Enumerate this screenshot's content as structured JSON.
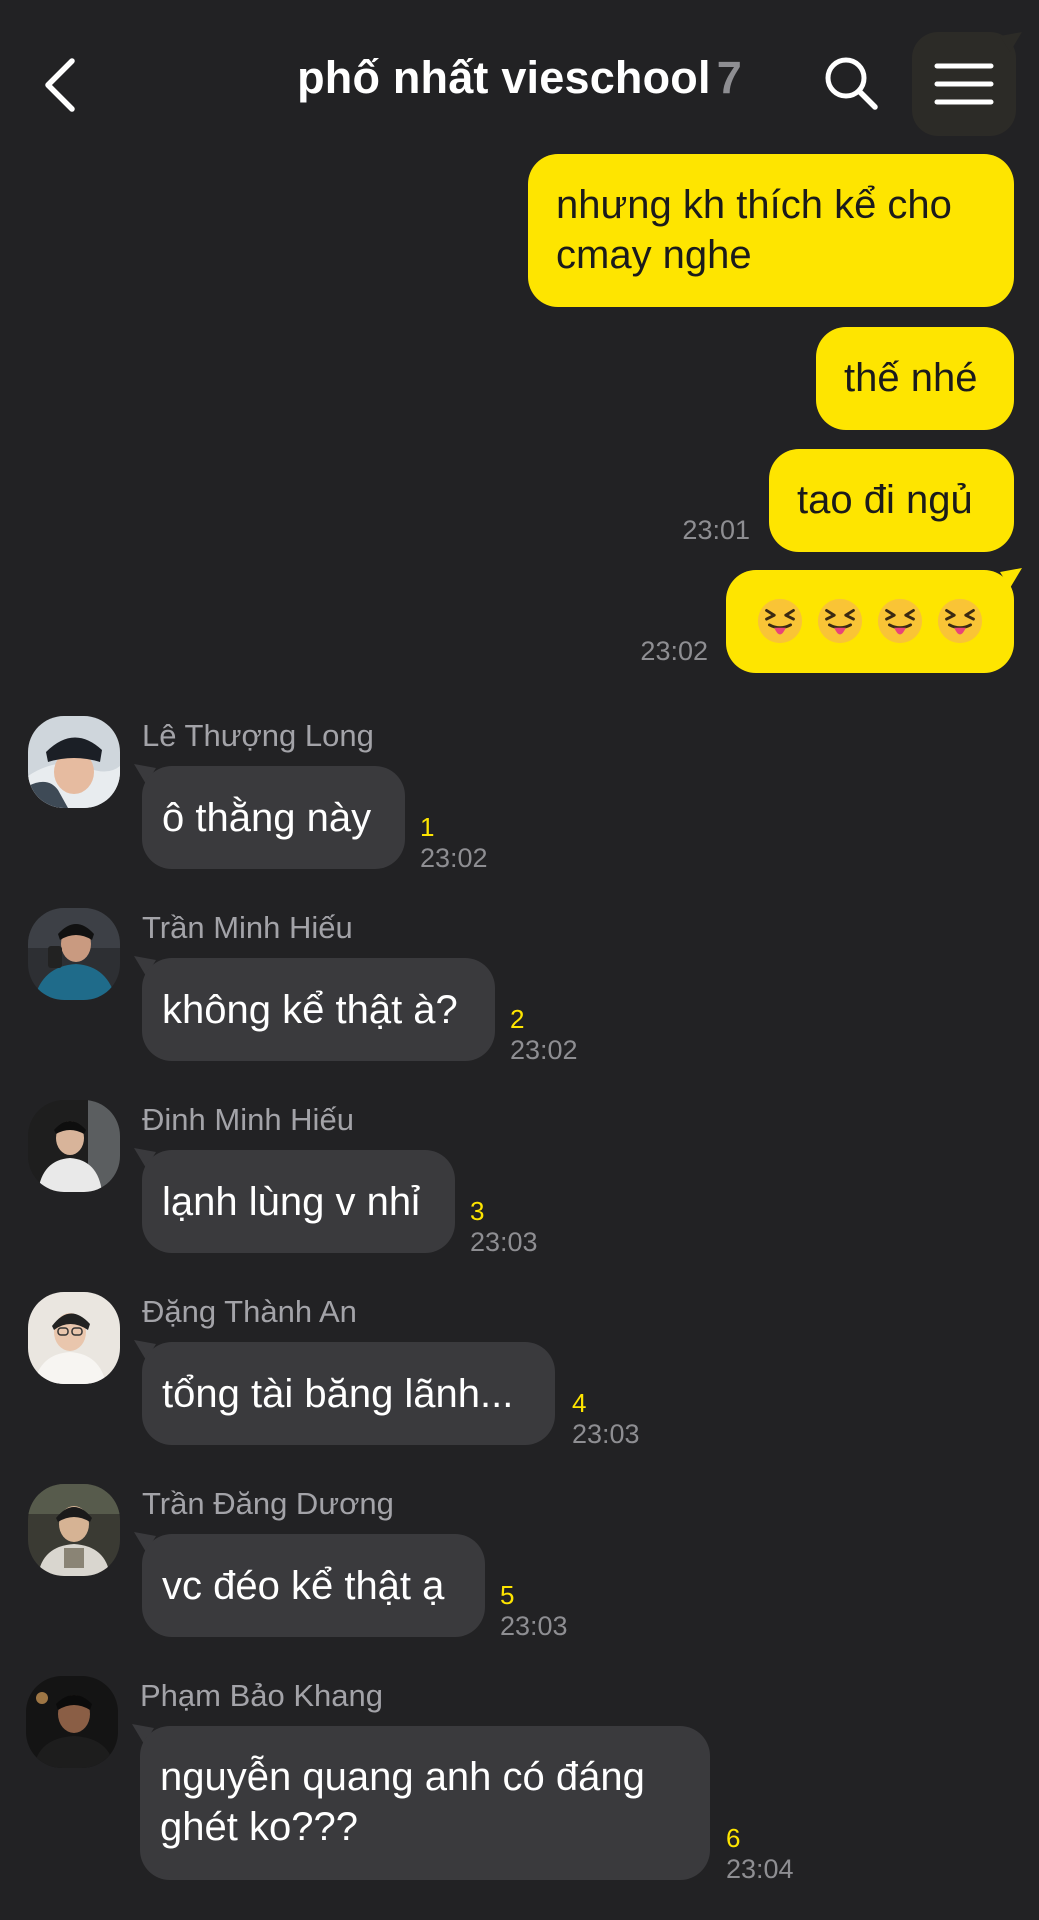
{
  "header": {
    "title": "phố nhất vieschool",
    "member_count": "7"
  },
  "colors": {
    "background": "#222224",
    "outgoing_bubble": "#fee500",
    "incoming_bubble": "#3a3a3d",
    "unread_count": "#fee500"
  },
  "outgoing_messages": [
    {
      "text_line1": "nhưng kh thích kể cho",
      "text_line2": "cmay nghe",
      "time": ""
    },
    {
      "text": "thế nhé",
      "time": ""
    },
    {
      "text": "tao đi ngủ",
      "time": "23:01"
    },
    {
      "emoji": "squinting-face-with-tongue",
      "emoji_count": 4,
      "time": "23:02"
    }
  ],
  "incoming_messages": [
    {
      "sender": "Lê Thượng Long",
      "text": "ô thằng này",
      "unread": "1",
      "time": "23:02"
    },
    {
      "sender": "Trần Minh Hiếu",
      "text": "không kể thật à?",
      "unread": "2",
      "time": "23:02"
    },
    {
      "sender": "Đinh Minh Hiếu",
      "text": "lạnh lùng v nhỉ",
      "unread": "3",
      "time": "23:03"
    },
    {
      "sender": "Đặng Thành An",
      "text": "tổng tài băng lãnh...",
      "unread": "4",
      "time": "23:03"
    },
    {
      "sender": "Trần Đăng Dương",
      "text": "vc đéo kể thật ạ",
      "unread": "5",
      "time": "23:03"
    },
    {
      "sender": "Phạm Bảo Khang",
      "text_line1": "nguyễn quang anh có đáng",
      "text_line2": "ghét ko???",
      "unread": "6",
      "time": "23:04"
    }
  ]
}
